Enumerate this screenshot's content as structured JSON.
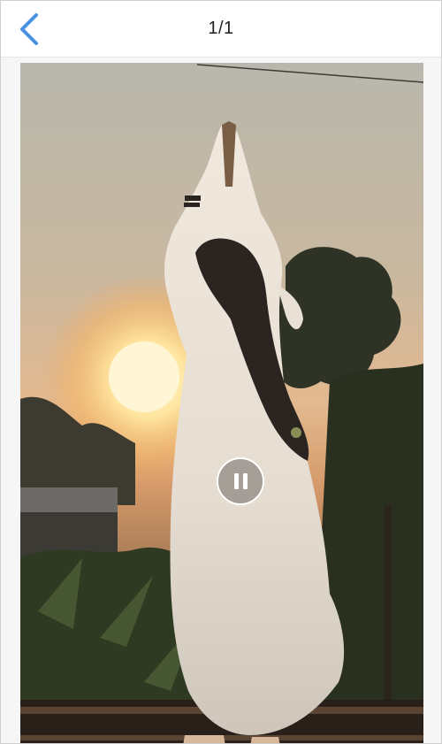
{
  "header": {
    "back_icon": "chevron-left-icon",
    "counter": "1/1"
  },
  "player": {
    "control_icon": "pause-icon",
    "state": "playing"
  },
  "colors": {
    "back_accent": "#4a90e2",
    "header_bg": "#ffffff",
    "viewer_bg": "#f6f6f6"
  }
}
